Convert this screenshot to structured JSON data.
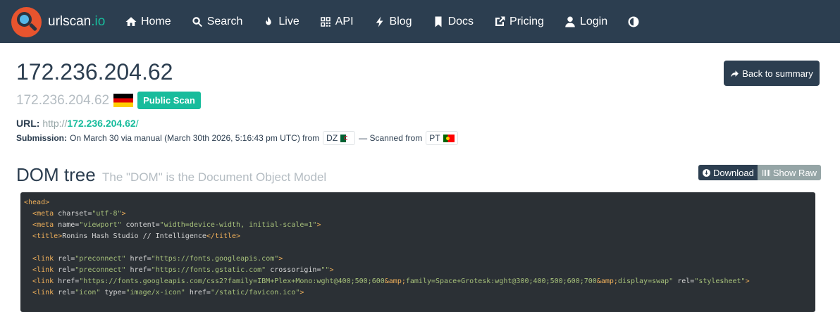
{
  "brand": {
    "name": "urlscan",
    "tld": ".io"
  },
  "nav": [
    {
      "label": "Home",
      "icon": "home-icon"
    },
    {
      "label": "Search",
      "icon": "search-icon"
    },
    {
      "label": "Live",
      "icon": "fire-icon"
    },
    {
      "label": "API",
      "icon": "qrcode-icon"
    },
    {
      "label": "Blog",
      "icon": "bolt-icon"
    },
    {
      "label": "Docs",
      "icon": "bookmark-icon"
    },
    {
      "label": "Pricing",
      "icon": "external-link-icon"
    },
    {
      "label": "Login",
      "icon": "user-icon"
    },
    {
      "label": "",
      "icon": "contrast-icon"
    }
  ],
  "header": {
    "title": "172.236.204.62",
    "sub_ip": "172.236.204.62",
    "flag": "DE",
    "badge": "Public Scan",
    "back_button": "Back to summary"
  },
  "url": {
    "label": "URL:",
    "scheme": "http://",
    "host": "172.236.204.62",
    "path": "/"
  },
  "submission": {
    "label": "Submission:",
    "text": "On March 30 via manual (March 30th 2026, 5:16:43 pm UTC) from",
    "from_country": "DZ",
    "scanned_text": "— Scanned from",
    "scanned_country": "PT"
  },
  "dom": {
    "title": "DOM tree",
    "subtitle": "The \"DOM\" is the Document Object Model",
    "download_label": "Download",
    "raw_label": "Show Raw"
  },
  "code_lines": {
    "l1": {
      "open": "<head>"
    },
    "l2": {
      "open": "<meta",
      "a1": " charset=",
      "v1": "\"utf-8\"",
      "close": ">"
    },
    "l3": {
      "open": "<meta",
      "a1": " name=",
      "v1": "\"viewport\"",
      "a2": " content=",
      "v2": "\"width=device-width, initial-scale=1\"",
      "close": ">"
    },
    "l4": {
      "open": "<title>",
      "text": "Ronins Hash Studio // Intelligence",
      "close": "</title>"
    },
    "l6": {
      "open": "<link",
      "a1": " rel=",
      "v1": "\"preconnect\"",
      "a2": " href=",
      "v2": "\"https://fonts.googleapis.com\"",
      "close": ">"
    },
    "l7": {
      "open": "<link",
      "a1": " rel=",
      "v1": "\"preconnect\"",
      "a2": " href=",
      "v2": "\"https://fonts.gstatic.com\"",
      "a3": " crossorigin=",
      "v3": "\"\"",
      "close": ">"
    },
    "l8": {
      "open": "<link",
      "a1": " href=",
      "v1": "\"https://fonts.googleapis.com/css2?family=IBM+Plex+Mono:wght@400;500;600",
      "e1": "&amp;",
      "v1b": "family=Space+Grotesk:wght@300;400;500;600;700",
      "e2": "&amp;",
      "v1c": "display=swap\"",
      "a2": " rel=",
      "v2": "\"stylesheet\"",
      "close": ">"
    },
    "l9": {
      "open": "<link",
      "a1": " rel=",
      "v1": "\"icon\"",
      "a2": " type=",
      "v2": "\"image/x-icon\"",
      "a3": " href=",
      "v3": "\"/static/favicon.ico\"",
      "close": ">"
    }
  }
}
